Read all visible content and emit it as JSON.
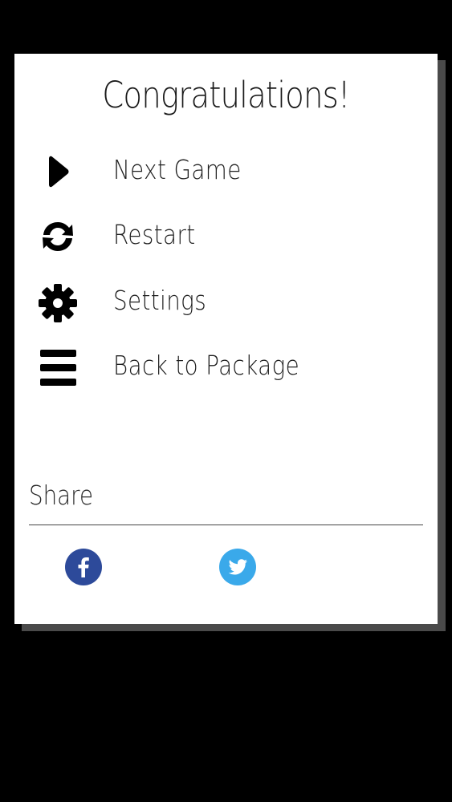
{
  "dialog": {
    "title": "Congratulations!",
    "menu": [
      {
        "label": "Next Game",
        "icon": "play-icon"
      },
      {
        "label": "Restart",
        "icon": "refresh-icon"
      },
      {
        "label": "Settings",
        "icon": "gear-icon"
      },
      {
        "label": "Back to Package",
        "icon": "hamburger-menu-icon"
      }
    ],
    "share": {
      "label": "Share",
      "networks": [
        {
          "icon": "facebook-icon",
          "color": "#2d4a9a"
        },
        {
          "icon": "twitter-icon",
          "color": "#3aa9ea"
        }
      ]
    }
  },
  "colors": {
    "backdrop": "#000000",
    "dialog": "#ffffff",
    "shadow": "#4a4a4a",
    "text": "#1f1f1f"
  }
}
